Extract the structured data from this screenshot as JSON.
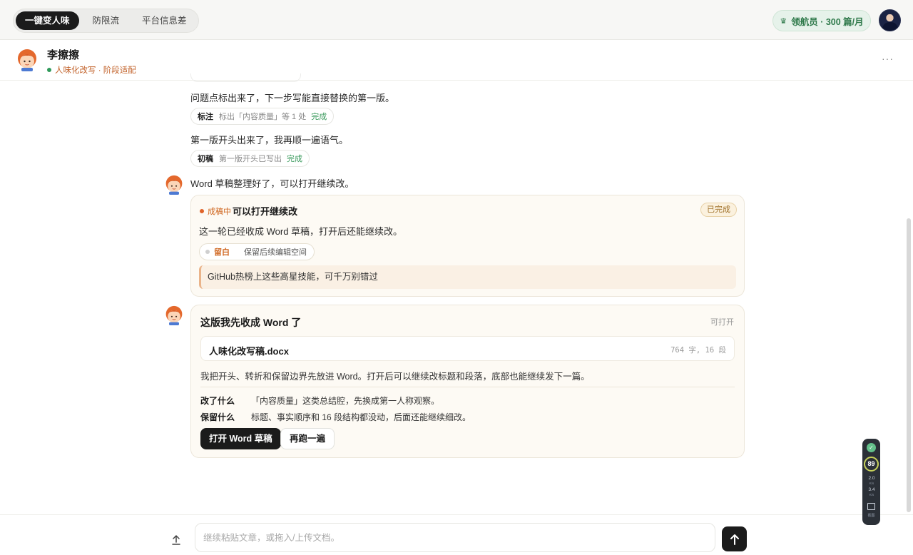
{
  "topbar": {
    "tabs": [
      {
        "label": "一键变人味",
        "active": true
      },
      {
        "label": "防限流",
        "active": false
      },
      {
        "label": "平台信息差",
        "active": false
      }
    ],
    "plan_label": "领航员 · 300 篇/月",
    "plan_icon": "crown-icon"
  },
  "chat_header": {
    "name": "李擦擦",
    "status": "人味化改写 · 阶段适配",
    "more_icon": "ellipsis-icon"
  },
  "messages": [
    {
      "text": "问题点标出来了，下一步写能直接替换的第一版。",
      "chip": {
        "key": "标注",
        "value": "标出「内容质量」等 1 处",
        "status": "完成"
      }
    },
    {
      "text": "第一版开头出来了，我再顺一遍语气。",
      "chip": {
        "key": "初稿",
        "value": "第一版开头已写出",
        "status": "完成"
      }
    },
    {
      "text": "Word 草稿整理好了，可以打开继续改。"
    }
  ],
  "draft_card": {
    "state": "成稿中",
    "title": "可以打开继续改",
    "badge": "已完成",
    "desc": "这一轮已经收成 Word 草稿，打开后还能继续改。",
    "chip_key": "留白",
    "chip_value": "保留后续编辑空间",
    "quote": "GitHub热榜上这些高星技能，可千万别错过"
  },
  "doc_card": {
    "title": "这版我先收成 Word 了",
    "open_hint": "可打开",
    "file_name": "人味化改写稿.docx",
    "file_meta": "764 字, 16 段",
    "desc": "我把开头、转折和保留边界先放进 Word。打开后可以继续改标题和段落，底部也能继续发下一篇。",
    "rows": [
      {
        "key": "改了什么",
        "value": "「内容质量」这类总结腔，先换成第一人称观察。"
      },
      {
        "key": "保留什么",
        "value": "标题、事实顺序和 16 段结构都没动，后面还能继续细改。"
      }
    ],
    "primary_button": "打开 Word 草稿",
    "secondary_button": "再跑一遍"
  },
  "composer": {
    "placeholder": "继续粘贴文章，或拖入/上传文档。",
    "value": ""
  },
  "widget": {
    "score": "89",
    "up_speed": "2.0",
    "down_speed": "3.4",
    "speed_unit": "K/s",
    "shot_label": "截图"
  },
  "colors": {
    "accent_dark": "#1b1b1b",
    "brand_green": "#2f7a4b",
    "status_orange": "#d0661f",
    "success_green": "#3a9a5c",
    "card_bg": "#fdfaf4"
  }
}
